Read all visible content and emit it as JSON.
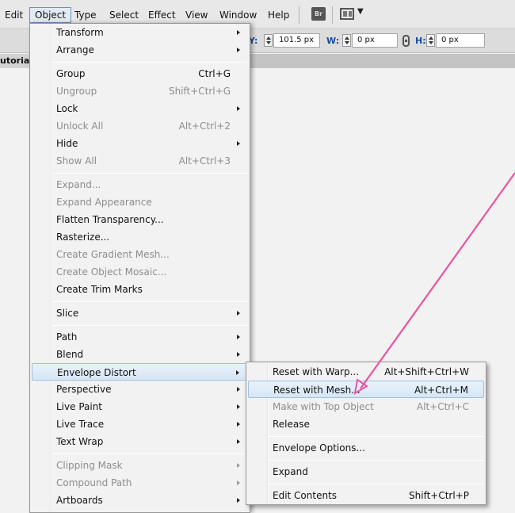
{
  "menubar": {
    "items": [
      {
        "label": "Edit"
      },
      {
        "label": "Object"
      },
      {
        "label": "Type"
      },
      {
        "label": "Select"
      },
      {
        "label": "Effect"
      },
      {
        "label": "View"
      },
      {
        "label": "Window"
      },
      {
        "label": "Help"
      }
    ],
    "bridge_label": "Br"
  },
  "controlbar": {
    "y_label": "Y:",
    "y_value": "101.5 px",
    "w_label": "W:",
    "w_value": "0 px",
    "h_label": "H:",
    "h_value": "0 px"
  },
  "document_tab": {
    "label": "utorialS"
  },
  "object_menu": {
    "items": [
      {
        "label": "Transform",
        "shortcut": "",
        "submenu": true,
        "disabled": false
      },
      {
        "label": "Arrange",
        "shortcut": "",
        "submenu": true,
        "disabled": false
      },
      {
        "label": "Group",
        "shortcut": "Ctrl+G",
        "submenu": false,
        "disabled": false
      },
      {
        "label": "Ungroup",
        "shortcut": "Shift+Ctrl+G",
        "submenu": false,
        "disabled": true
      },
      {
        "label": "Lock",
        "shortcut": "",
        "submenu": true,
        "disabled": false
      },
      {
        "label": "Unlock All",
        "shortcut": "Alt+Ctrl+2",
        "submenu": false,
        "disabled": true
      },
      {
        "label": "Hide",
        "shortcut": "",
        "submenu": true,
        "disabled": false
      },
      {
        "label": "Show All",
        "shortcut": "Alt+Ctrl+3",
        "submenu": false,
        "disabled": true
      },
      {
        "label": "Expand...",
        "shortcut": "",
        "submenu": false,
        "disabled": true
      },
      {
        "label": "Expand Appearance",
        "shortcut": "",
        "submenu": false,
        "disabled": true
      },
      {
        "label": "Flatten Transparency...",
        "shortcut": "",
        "submenu": false,
        "disabled": false
      },
      {
        "label": "Rasterize...",
        "shortcut": "",
        "submenu": false,
        "disabled": false
      },
      {
        "label": "Create Gradient Mesh...",
        "shortcut": "",
        "submenu": false,
        "disabled": true
      },
      {
        "label": "Create Object Mosaic...",
        "shortcut": "",
        "submenu": false,
        "disabled": true
      },
      {
        "label": "Create Trim Marks",
        "shortcut": "",
        "submenu": false,
        "disabled": false
      },
      {
        "label": "Slice",
        "shortcut": "",
        "submenu": true,
        "disabled": false
      },
      {
        "label": "Path",
        "shortcut": "",
        "submenu": true,
        "disabled": false
      },
      {
        "label": "Blend",
        "shortcut": "",
        "submenu": true,
        "disabled": false
      },
      {
        "label": "Envelope Distort",
        "shortcut": "",
        "submenu": true,
        "disabled": false,
        "highlighted": true
      },
      {
        "label": "Perspective",
        "shortcut": "",
        "submenu": true,
        "disabled": false
      },
      {
        "label": "Live Paint",
        "shortcut": "",
        "submenu": true,
        "disabled": false
      },
      {
        "label": "Live Trace",
        "shortcut": "",
        "submenu": true,
        "disabled": false
      },
      {
        "label": "Text Wrap",
        "shortcut": "",
        "submenu": true,
        "disabled": false
      },
      {
        "label": "Clipping Mask",
        "shortcut": "",
        "submenu": true,
        "disabled": true
      },
      {
        "label": "Compound Path",
        "shortcut": "",
        "submenu": true,
        "disabled": true
      },
      {
        "label": "Artboards",
        "shortcut": "",
        "submenu": true,
        "disabled": false
      }
    ]
  },
  "envelope_submenu": {
    "items": [
      {
        "label": "Reset with Warp...",
        "shortcut": "Alt+Shift+Ctrl+W",
        "disabled": false
      },
      {
        "label": "Reset with Mesh...",
        "shortcut": "Alt+Ctrl+M",
        "disabled": false,
        "highlighted": true
      },
      {
        "label": "Make with Top Object",
        "shortcut": "Alt+Ctrl+C",
        "disabled": true
      },
      {
        "label": "Release",
        "shortcut": "",
        "disabled": false
      },
      {
        "label": "Envelope Options...",
        "shortcut": "",
        "disabled": false
      },
      {
        "label": "Expand",
        "shortcut": "",
        "disabled": false
      },
      {
        "label": "Edit Contents",
        "shortcut": "Shift+Ctrl+P",
        "disabled": false
      }
    ]
  },
  "colors": {
    "annotation_arrow": "#e8559f",
    "highlight": "#d6e6f6",
    "disabled_text": "#8d8d8d"
  }
}
